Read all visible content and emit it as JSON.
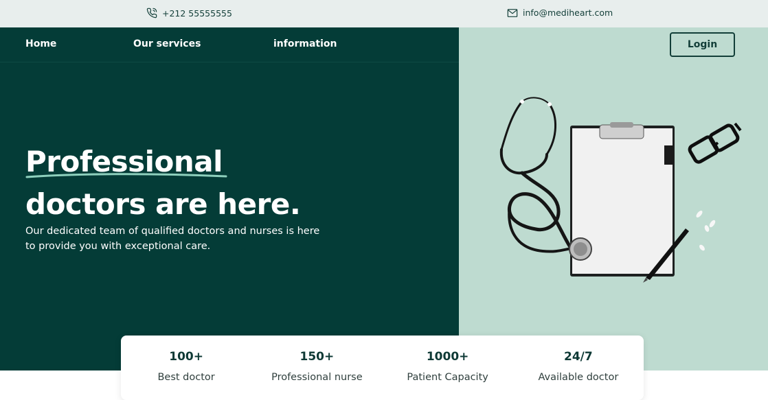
{
  "topbar": {
    "phone": {
      "icon": "phone-icon",
      "text": "+212 55555555"
    },
    "email": {
      "icon": "mail-icon",
      "text": "info@mediheart.com"
    }
  },
  "nav": {
    "items": [
      {
        "label": "Home"
      },
      {
        "label": "Our services"
      },
      {
        "label": "information"
      }
    ],
    "login_label": "Login"
  },
  "hero": {
    "headline_line1": "Professional",
    "headline_line2": "doctors are here.",
    "subtitle": "Our dedicated team of qualified doctors and nurses is here to provide you with exceptional care.",
    "illustration": "stethoscope-clipboard-glasses-pen-icon"
  },
  "stats": [
    {
      "value": "100+",
      "label": "Best doctor"
    },
    {
      "value": "150+",
      "label": "Professional nurse"
    },
    {
      "value": "1000+",
      "label": "Patient Capacity"
    },
    {
      "value": "24/7",
      "label": "Available doctor"
    }
  ],
  "colors": {
    "hero_dark": "#043c37",
    "hero_light": "#bedbd0",
    "topbar": "#e8eeed",
    "text_dark": "#0e3935"
  }
}
